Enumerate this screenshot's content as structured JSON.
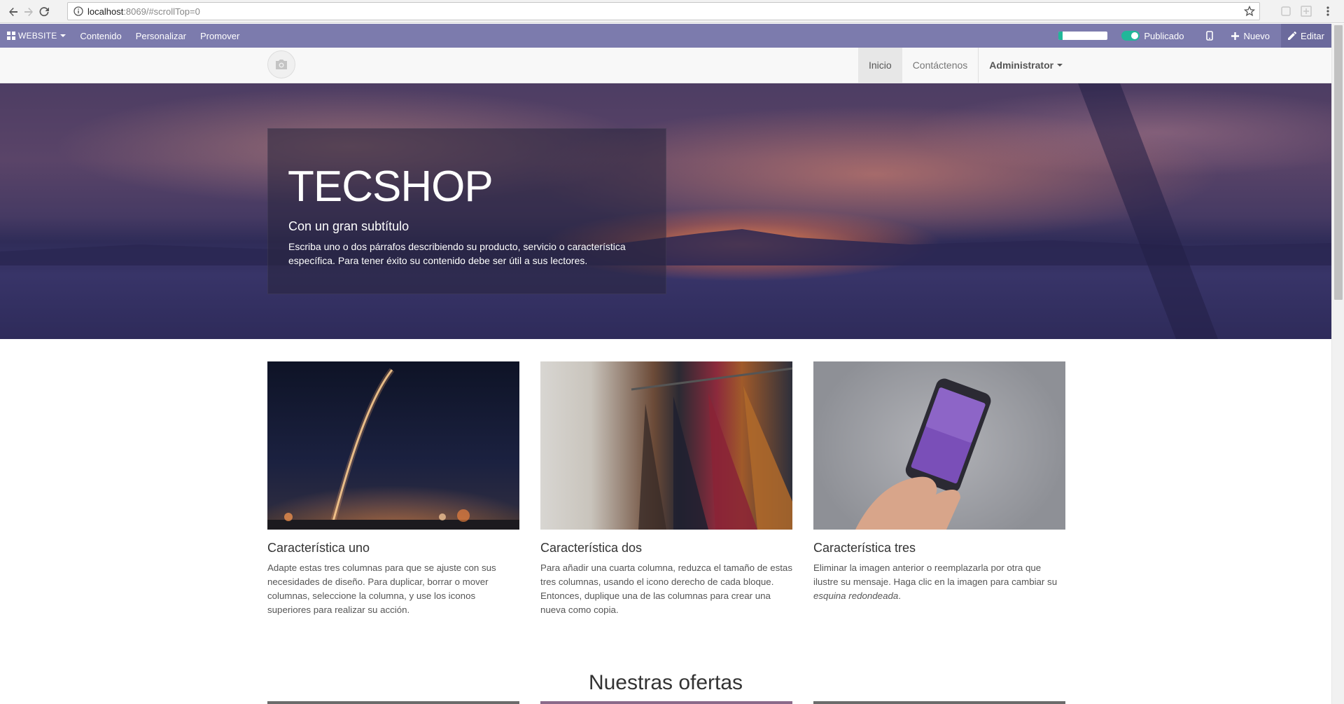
{
  "browser": {
    "url_host": "localhost",
    "url_path": ":8069/#scrollTop=0"
  },
  "admin_bar": {
    "website_label": "WEBSITE",
    "menu": [
      "Contenido",
      "Personalizar",
      "Promover"
    ],
    "publish_progress": 0.08,
    "published_label": "Publicado",
    "new_label": "Nuevo",
    "edit_label": "Editar",
    "accent_color": "#7c7bad",
    "toggle_color": "#21b799"
  },
  "site_nav": {
    "items": [
      "Inicio",
      "Contáctenos"
    ],
    "user": "Administrator"
  },
  "hero": {
    "title": "TECSHOP",
    "subtitle": "Con un gran subtítulo",
    "text": "Escriba uno o dos párrafos describiendo su producto, servicio o característica específica. Para tener éxito su contenido debe ser útil a sus lectores."
  },
  "features": [
    {
      "title": "Característica uno",
      "text": "Adapte estas tres columnas para que se ajuste con sus necesidades de diseño. Para duplicar, borrar o mover columnas, seleccione la columna, y use los iconos superiores para realizar su acción."
    },
    {
      "title": "Característica dos",
      "text": "Para añadir una cuarta columna, reduzca el tamaño de estas tres columnas, usando el icono derecho de cada bloque. Entonces, duplique una de las columnas para crear una nueva como copia."
    },
    {
      "title": "Característica tres",
      "text": "Eliminar la imagen anterior o reemplazarla por otra que ilustre su mensaje. Haga clic en la imagen para cambiar su ",
      "text_em": "esquina redondeada",
      "text_end": "."
    }
  ],
  "offers": {
    "title": "Nuestras ofertas"
  },
  "icons": {
    "back": "arrow-left-icon",
    "forward": "arrow-right-icon",
    "reload": "reload-icon",
    "info": "info-icon",
    "bookmark": "star-icon",
    "apps": "grid-icon",
    "mobile": "mobile-icon",
    "plus": "plus-icon",
    "pencil": "pencil-icon",
    "logo": "camera-icon"
  }
}
